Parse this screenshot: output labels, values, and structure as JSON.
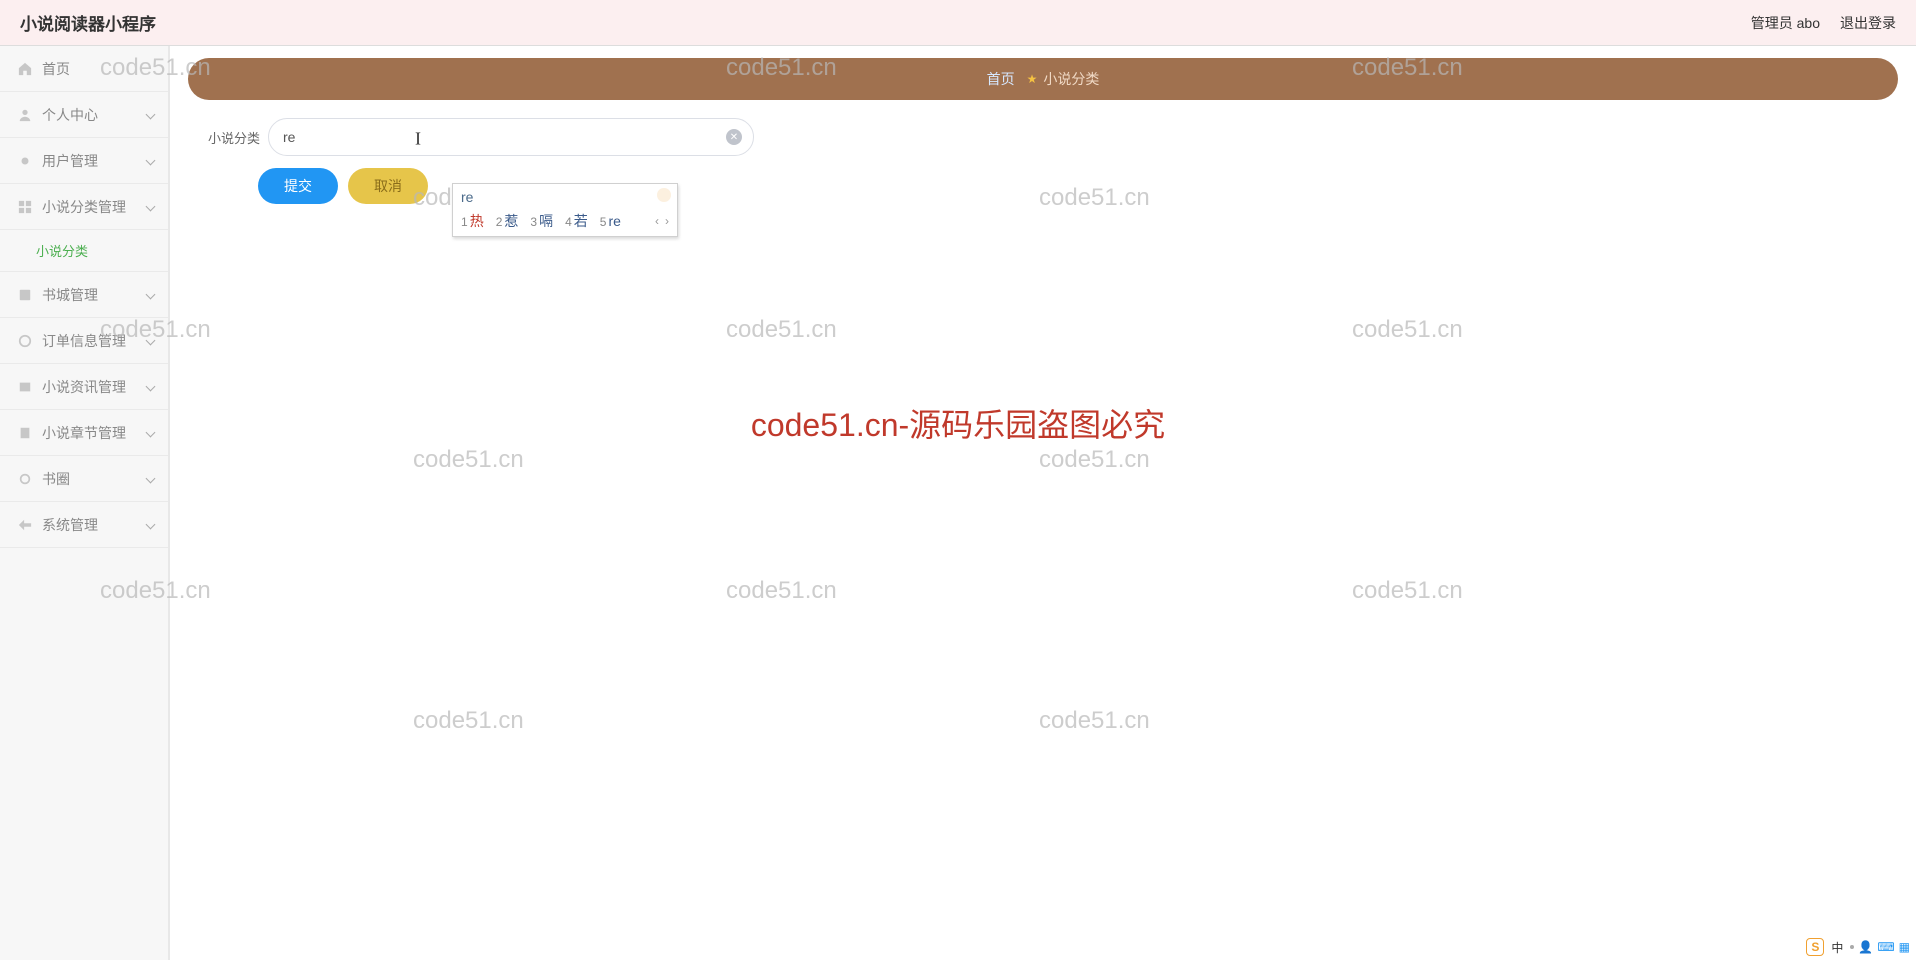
{
  "header": {
    "title": "小说阅读器小程序",
    "admin_label": "管理员 abo",
    "logout_label": "退出登录"
  },
  "sidebar": {
    "items": [
      {
        "label": "首页",
        "icon": "home-icon",
        "expandable": false
      },
      {
        "label": "个人中心",
        "icon": "user-icon",
        "expandable": true
      },
      {
        "label": "用户管理",
        "icon": "dot-icon",
        "expandable": true
      },
      {
        "label": "小说分类管理",
        "icon": "category-icon",
        "expandable": true,
        "expanded": true,
        "children": [
          {
            "label": "小说分类"
          }
        ]
      },
      {
        "label": "书城管理",
        "icon": "book-icon",
        "expandable": true
      },
      {
        "label": "订单信息管理",
        "icon": "order-icon",
        "expandable": true
      },
      {
        "label": "小说资讯管理",
        "icon": "news-icon",
        "expandable": true
      },
      {
        "label": "小说章节管理",
        "icon": "chapter-icon",
        "expandable": true
      },
      {
        "label": "书圈",
        "icon": "circle-icon",
        "expandable": true
      },
      {
        "label": "系统管理",
        "icon": "system-icon",
        "expandable": true
      }
    ]
  },
  "breadcrumb": {
    "home": "首页",
    "current": "小说分类"
  },
  "form": {
    "category_label": "小说分类",
    "category_value": "re",
    "submit_label": "提交",
    "cancel_label": "取消"
  },
  "ime": {
    "composition": "re",
    "candidates": [
      {
        "num": "1",
        "char": "热"
      },
      {
        "num": "2",
        "char": "惹"
      },
      {
        "num": "3",
        "char": "嗝"
      },
      {
        "num": "4",
        "char": "若"
      },
      {
        "num": "5",
        "char": "re"
      }
    ],
    "prev": "‹",
    "next": "›"
  },
  "watermarks": {
    "text": "code51.cn",
    "center": "code51.cn-源码乐园盗图必究"
  },
  "sogou": {
    "s": "S",
    "ch": "中"
  }
}
